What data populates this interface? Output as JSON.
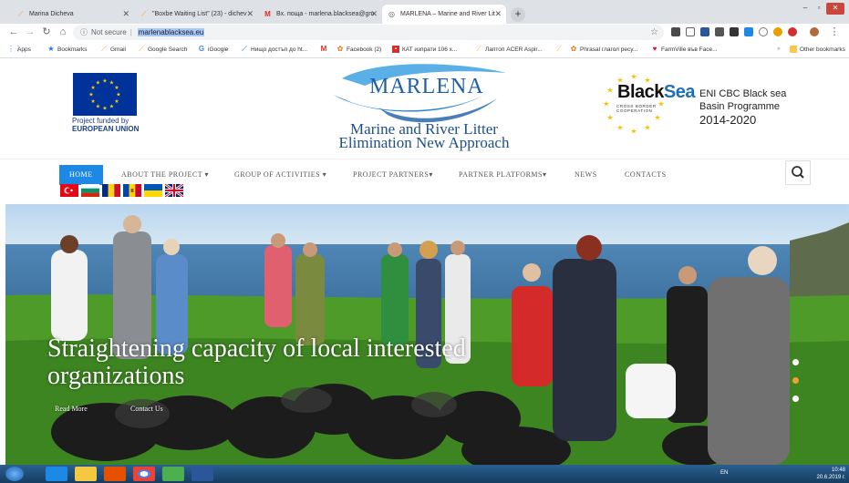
{
  "browser": {
    "tabs": [
      {
        "title": "Marina Dicheva",
        "icon_color": "#f4a300",
        "active": false
      },
      {
        "title": "\"Boxbe Waiting List\" (23) - dichev",
        "icon_color": "#f4a300",
        "active": false
      },
      {
        "title": "Вх. поща - marlena.blacksea@gm",
        "icon_color": "#d93025",
        "active": false
      },
      {
        "title": "MARLENA – Marine and River Lit",
        "icon_color": "#555555",
        "active": true
      }
    ],
    "address": {
      "security": "Not secure",
      "url": "marlenablacksea.eu"
    },
    "bookmarks": [
      {
        "label": "Apps",
        "icon": "apps-grid-icon"
      },
      {
        "label": "Bookmarks",
        "icon": "star-icon"
      },
      {
        "label": "Gmail",
        "icon": "bookmark-icon"
      },
      {
        "label": "Google Search",
        "icon": "bookmark-icon"
      },
      {
        "label": "iGoogle",
        "icon": "google-icon"
      },
      {
        "label": "Нищо достъп до ht...",
        "icon": "bookmark-icon"
      },
      {
        "label": "",
        "icon": "gmail-icon"
      },
      {
        "label": "Facebook (2)",
        "icon": "facebook-icon"
      },
      {
        "label": "КАТ изпрати 106 х...",
        "icon": "bookmark-icon"
      },
      {
        "label": "Лаптоп ACER Aspir...",
        "icon": "bookmark-icon"
      },
      {
        "label": "",
        "icon": "bookmark-icon"
      },
      {
        "label": "Phrasal глагол ресу...",
        "icon": "bookmark-icon"
      },
      {
        "label": "FarmVille във Face...",
        "icon": "heart-icon"
      },
      {
        "label": "Other bookmarks",
        "icon": "folder-icon"
      }
    ]
  },
  "header": {
    "eu_caption_line1": "Project funded by",
    "eu_caption_line2": "EUROPEAN UNION",
    "logo_word": "MARLENA",
    "logo_line1": "Marine and River Litter",
    "logo_line2": "Elimination New Approach",
    "blacksea_title_a": "Black",
    "blacksea_title_b": "Sea",
    "blacksea_sub_line1": "CROSS BORDER",
    "blacksea_sub_line2": "COOPERATION",
    "eni_line1": "ENI CBC Black sea",
    "eni_line2": "Basin Programme",
    "eni_years": "2014-2020"
  },
  "nav": {
    "items": [
      {
        "label": "HOME"
      },
      {
        "label": "ABOUT THE PROJECT ▾"
      },
      {
        "label": "GROUP OF ACTIVITIES ▾"
      },
      {
        "label": "PROJECT PARTNERS▾"
      },
      {
        "label": "PARTNER PLATFORMS▾"
      },
      {
        "label": "NEWS"
      },
      {
        "label": "CONTACTS"
      }
    ],
    "flags": [
      "turkey",
      "bulgaria",
      "romania",
      "moldova",
      "ukraine",
      "united-kingdom"
    ]
  },
  "hero": {
    "title_line1": "Straightening capacity of local interested",
    "title_line2": "organizations",
    "read_more": "Read More",
    "contact_us": "Contact Us",
    "slides": 3,
    "active_slide": 1
  },
  "taskbar": {
    "lang": "EN",
    "time": "10:48",
    "date": "20.6.2019 г."
  }
}
